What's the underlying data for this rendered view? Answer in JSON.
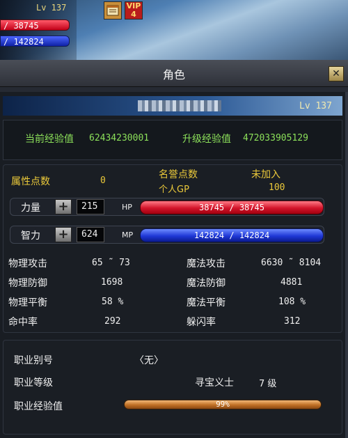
{
  "hud": {
    "level": "Lv 137",
    "hp_bar": "/ 38745",
    "mp_bar": "/ 142824",
    "icon_left": "scroll-icon",
    "icon_right": {
      "top": "VIP",
      "bottom": "4"
    }
  },
  "window": {
    "title": "角色",
    "close_icon": "close-icon"
  },
  "character": {
    "level": "Lv 137"
  },
  "experience": {
    "current_label": "当前经验值",
    "current_value": "62434230001",
    "next_label": "升级经验值",
    "next_value": "472033905129"
  },
  "attributes": {
    "points_label": "属性点数",
    "points_value": "0",
    "honor_label": "名誉点数",
    "honor_value": "未加入",
    "gp_label": "个人GP",
    "gp_value": "100",
    "strength_label": "力量",
    "strength_value": "215",
    "hp_label": "HP",
    "hp_text": "38745 / 38745",
    "hp_fill": 1.0,
    "intellect_label": "智力",
    "intellect_value": "624",
    "mp_label": "MP",
    "mp_text": "142824 / 142824",
    "mp_fill": 1.0
  },
  "stats": [
    {
      "label": "物理攻击",
      "value": "65 ˜ 73",
      "label2": "魔法攻击",
      "value2": "6630 ˜ 8104"
    },
    {
      "label": "物理防御",
      "value": "1698",
      "label2": "魔法防御",
      "value2": "4881"
    },
    {
      "label": "物理平衡",
      "value": "58 %",
      "label2": "魔法平衡",
      "value2": "108 %"
    },
    {
      "label": "命中率",
      "value": "292",
      "label2": "躲闪率",
      "value2": "312"
    }
  ],
  "job": {
    "alias_label": "职业别号",
    "alias_value": "〈无〉",
    "level_label": "职业等级",
    "class_name": "寻宝义士",
    "class_level": "7 级",
    "exp_label": "职业经验值",
    "exp_text": "99%",
    "exp_fill": 0.99
  },
  "colors": {
    "hp": "#d3142a",
    "mp": "#1f38d6",
    "label_green": "#8ce05a",
    "label_yellow": "#ebc93a",
    "job_bar": "#c07025"
  }
}
